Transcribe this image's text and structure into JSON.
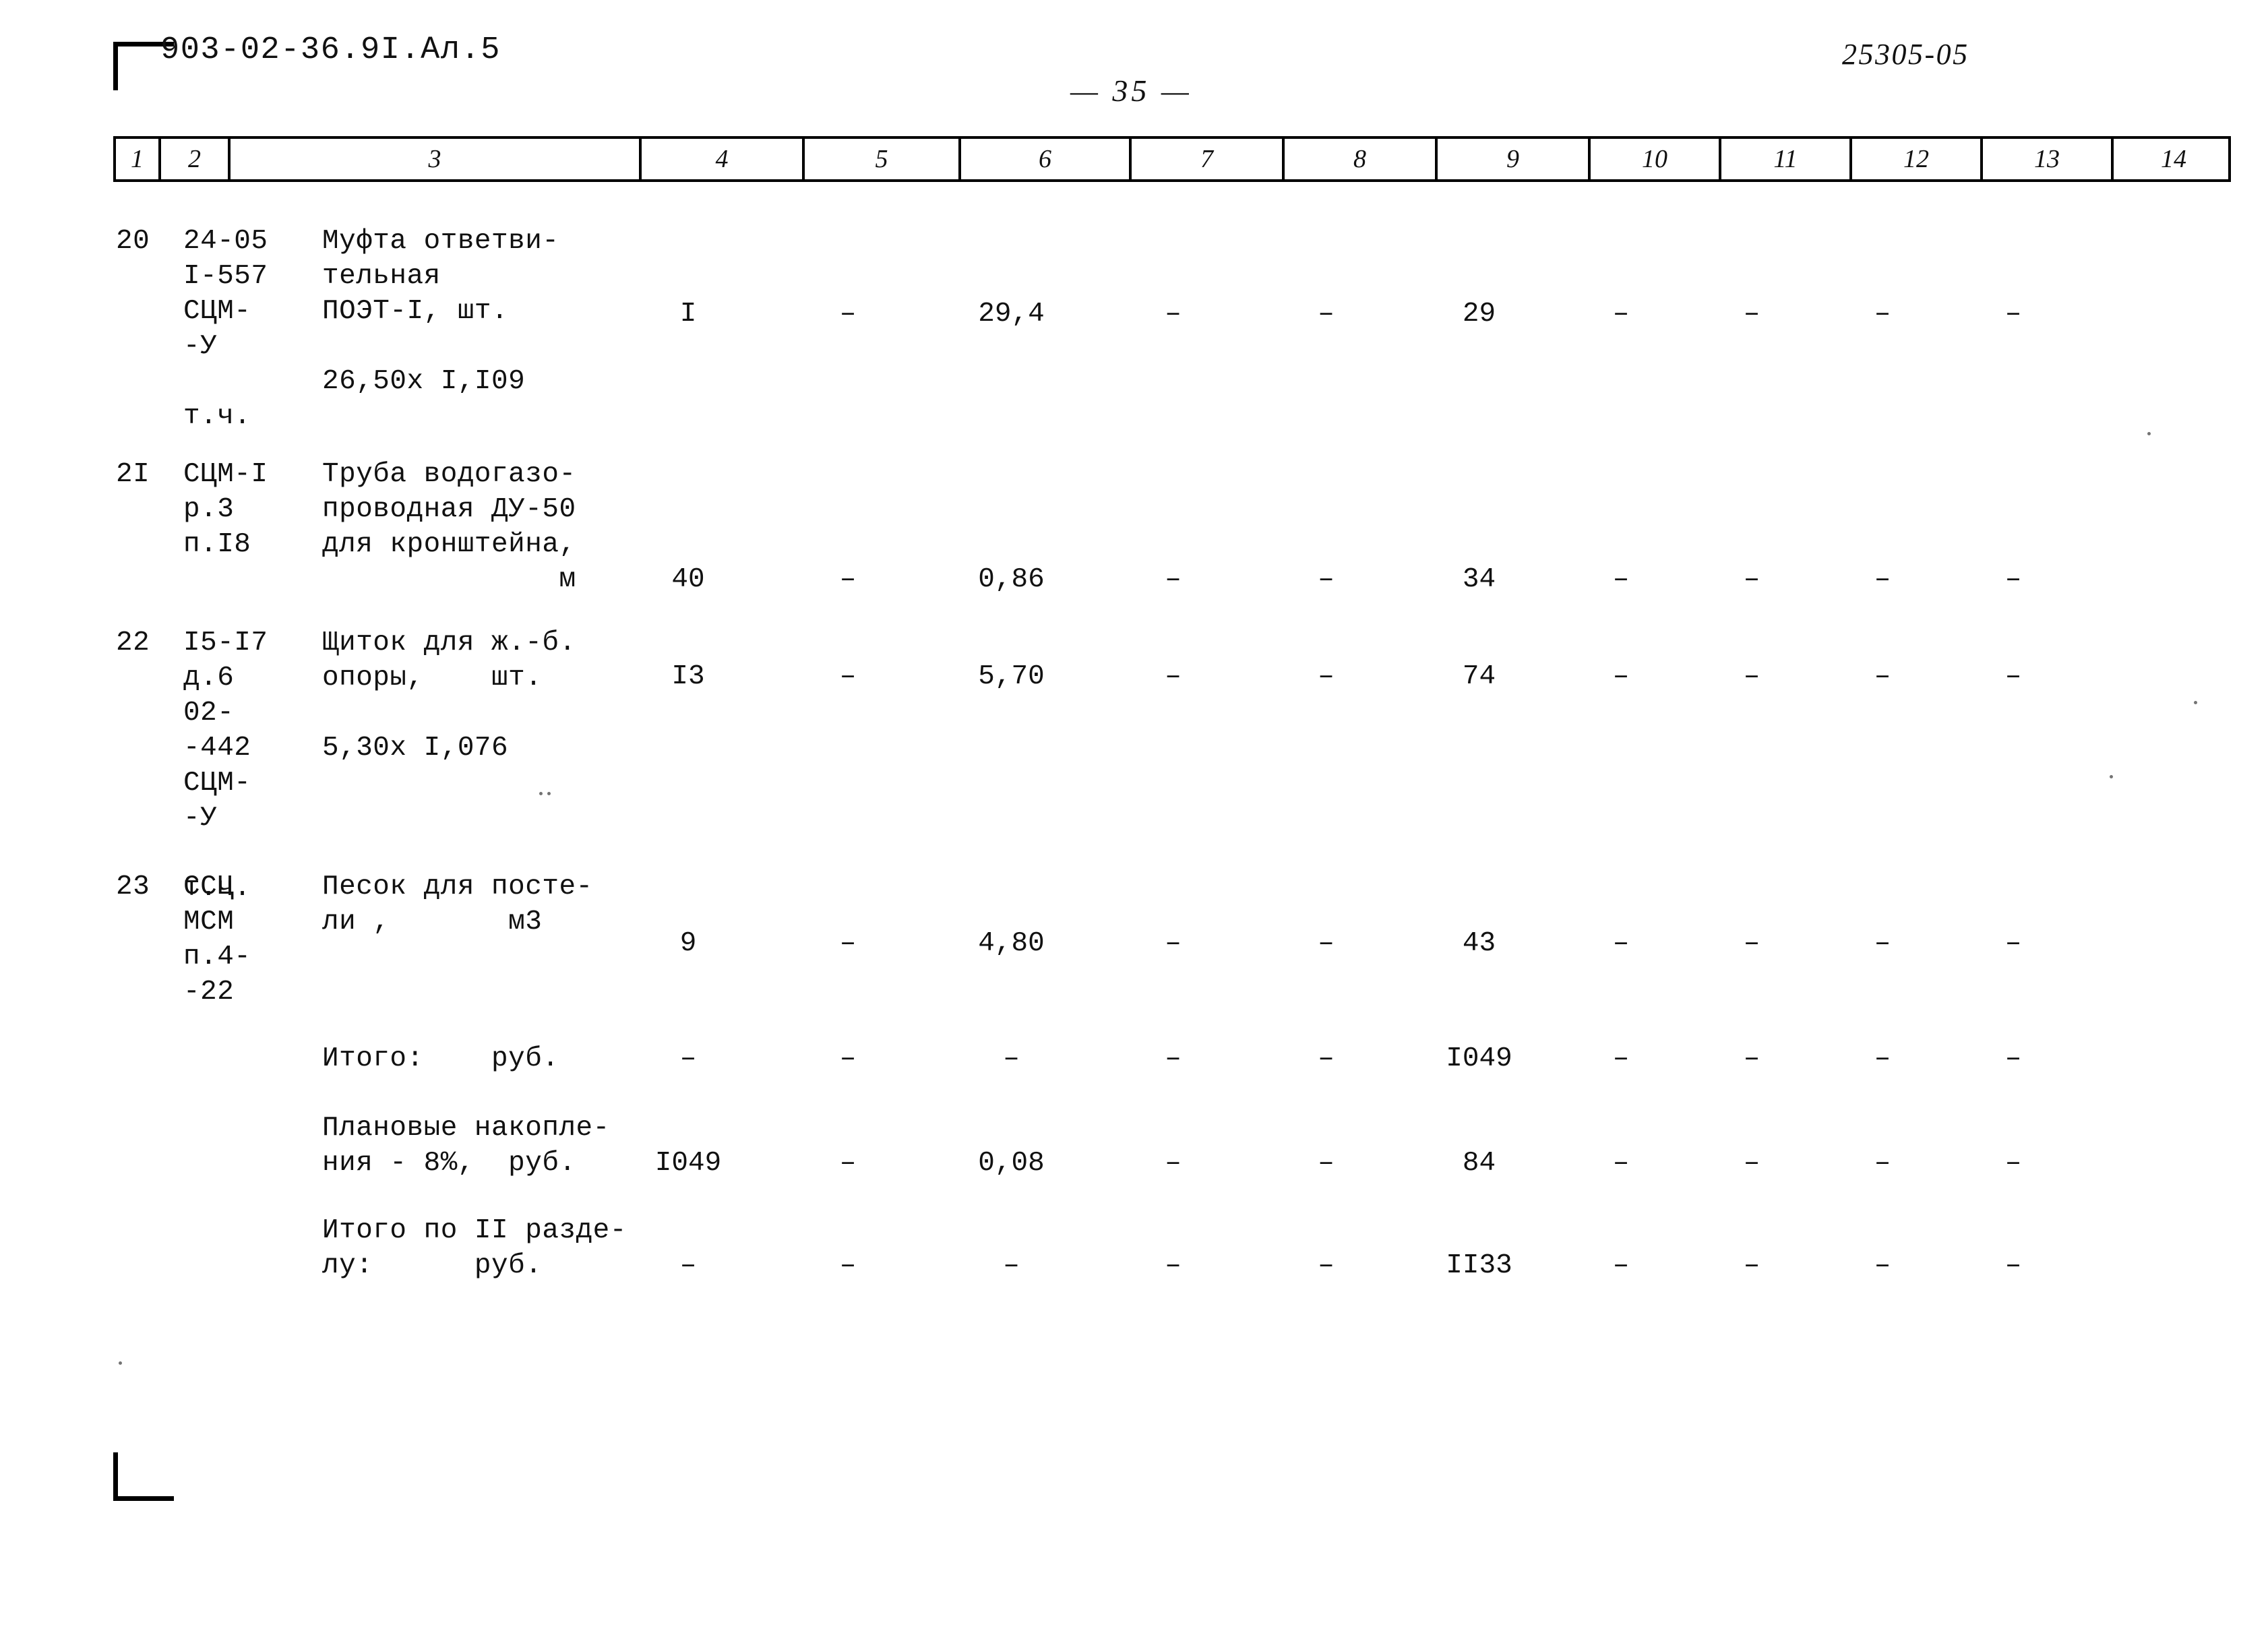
{
  "document": {
    "code": "903-02-36.9I.Ал.5",
    "archive_stamp": "25305-05",
    "page_marker": "— 35 —"
  },
  "table": {
    "column_headers": [
      "1",
      "2",
      "3",
      "4",
      "5",
      "6",
      "7",
      "8",
      "9",
      "10",
      "11",
      "12",
      "13",
      "14"
    ],
    "rows": [
      {
        "no": "20",
        "code_lines": [
          "24-05",
          "I-557",
          "СЦМ-",
          "-У",
          "",
          "т.ч."
        ],
        "desc_lines": [
          "Муфта ответви-",
          "тельная",
          "ПОЭТ-I, шт.",
          "",
          "26,50х I,I09"
        ],
        "c4": "I",
        "c5": "–",
        "c6": "29,4",
        "c7": "–",
        "c8": "–",
        "c9": "29",
        "c10": "–",
        "c11": "–",
        "c12": "–",
        "c13": "–",
        "c14": ""
      },
      {
        "no": "2I",
        "code_lines": [
          "СЦМ-I",
          "р.3",
          "п.I8"
        ],
        "desc_lines": [
          "Труба водогазо-",
          "проводная ДУ-50",
          "для кронштейна,",
          "              м"
        ],
        "c4": "40",
        "c5": "–",
        "c6": "0,86",
        "c7": "–",
        "c8": "–",
        "c9": "34",
        "c10": "–",
        "c11": "–",
        "c12": "–",
        "c13": "–",
        "c14": ""
      },
      {
        "no": "22",
        "code_lines": [
          "I5-I7",
          "д.6",
          "02-",
          "-442",
          "СЦМ-",
          "-У",
          "",
          "т.ч."
        ],
        "desc_lines": [
          "Щиток для ж.-б.",
          "опоры,    шт.",
          "",
          "5,30х I,076"
        ],
        "c4": "I3",
        "c5": "–",
        "c6": "5,70",
        "c7": "–",
        "c8": "–",
        "c9": "74",
        "c10": "–",
        "c11": "–",
        "c12": "–",
        "c13": "–",
        "c14": ""
      },
      {
        "no": "23",
        "code_lines": [
          "ССЦ",
          "МСМ",
          "п.4-",
          "-22"
        ],
        "desc_lines": [
          "Песок для посте-",
          "ли ,       м3"
        ],
        "c4": "9",
        "c5": "–",
        "c6": "4,80",
        "c7": "–",
        "c8": "–",
        "c9": "43",
        "c10": "–",
        "c11": "–",
        "c12": "–",
        "c13": "–",
        "c14": ""
      }
    ],
    "summary_rows": [
      {
        "label_lines": [
          "Итого:    руб."
        ],
        "c4": "–",
        "c5": "–",
        "c6": "–",
        "c7": "–",
        "c8": "–",
        "c9": "I049",
        "c10": "–",
        "c11": "–",
        "c12": "–",
        "c13": "–",
        "c14": ""
      },
      {
        "label_lines": [
          "Плановые накопле-",
          "ния - 8%,  руб."
        ],
        "c4": "I049",
        "c5": "–",
        "c6": "0,08",
        "c7": "–",
        "c8": "–",
        "c9": "84",
        "c10": "–",
        "c11": "–",
        "c12": "–",
        "c13": "–",
        "c14": ""
      },
      {
        "label_lines": [
          "Итого по II разде-",
          "лу:      руб."
        ],
        "c4": "–",
        "c5": "–",
        "c6": "–",
        "c7": "–",
        "c8": "–",
        "c9": "II33",
        "c10": "–",
        "c11": "–",
        "c12": "–",
        "c13": "–",
        "c14": ""
      }
    ]
  }
}
